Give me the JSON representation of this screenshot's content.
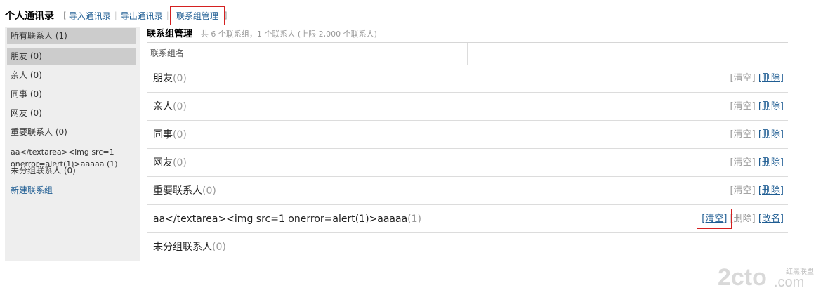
{
  "header": {
    "title": "个人通讯录",
    "bracket_open": "[",
    "bracket_close": "]",
    "links": [
      "导入通讯录",
      "导出通讯录",
      "联系组管理"
    ],
    "sep": "|"
  },
  "sidebar": {
    "items": [
      {
        "label": "所有联系人 (1)",
        "selected": true
      },
      {
        "label": "朋友 (0)",
        "selected": true
      },
      {
        "label": "亲人 (0)"
      },
      {
        "label": "同事 (0)"
      },
      {
        "label": "网友 (0)"
      },
      {
        "label": "重要联系人 (0)"
      }
    ],
    "tricky_group": "aa</textarea><img src=1 onerror=alert(1)>aaaaa (1)",
    "ungrouped": "未分组联系人 (0)",
    "new_group": "新建联系组"
  },
  "main": {
    "title": "联系组管理",
    "summary": "共 6 个联系组，1 个联系人 (上限 2,000 个联系人)",
    "column_header": "联系组名",
    "groups": [
      {
        "name": "朋友",
        "count": "(0)",
        "actions": "[清空] [删除]"
      },
      {
        "name": "亲人",
        "count": "(0)",
        "actions": "[清空] [删除]"
      },
      {
        "name": "同事",
        "count": "(0)",
        "actions": "[清空] [删除]"
      },
      {
        "name": "网友",
        "count": "(0)",
        "actions": "[清空] [删除]"
      },
      {
        "name": "重要联系人",
        "count": "(0)",
        "actions": "[清空] [删除]"
      },
      {
        "name": "aa</textarea><img src=1 onerror=alert(1)>aaaaa",
        "count": "(1)",
        "actions": "[清空] [删除] [改名]"
      },
      {
        "name": "未分组联系人",
        "count": "(0)"
      }
    ],
    "action_labels": {
      "clear": "[清空]",
      "delete": "[删除]",
      "rename": "[改名]"
    }
  },
  "watermark": {
    "brand": "2cto",
    "domain": ".com",
    "tag": "红黑联盟"
  },
  "colors": {
    "link": "#1f5d93",
    "muted": "#999999",
    "highlight": "#d42020",
    "sidebar_bg": "#eeeeee",
    "sidebar_selected": "#cccccc"
  }
}
